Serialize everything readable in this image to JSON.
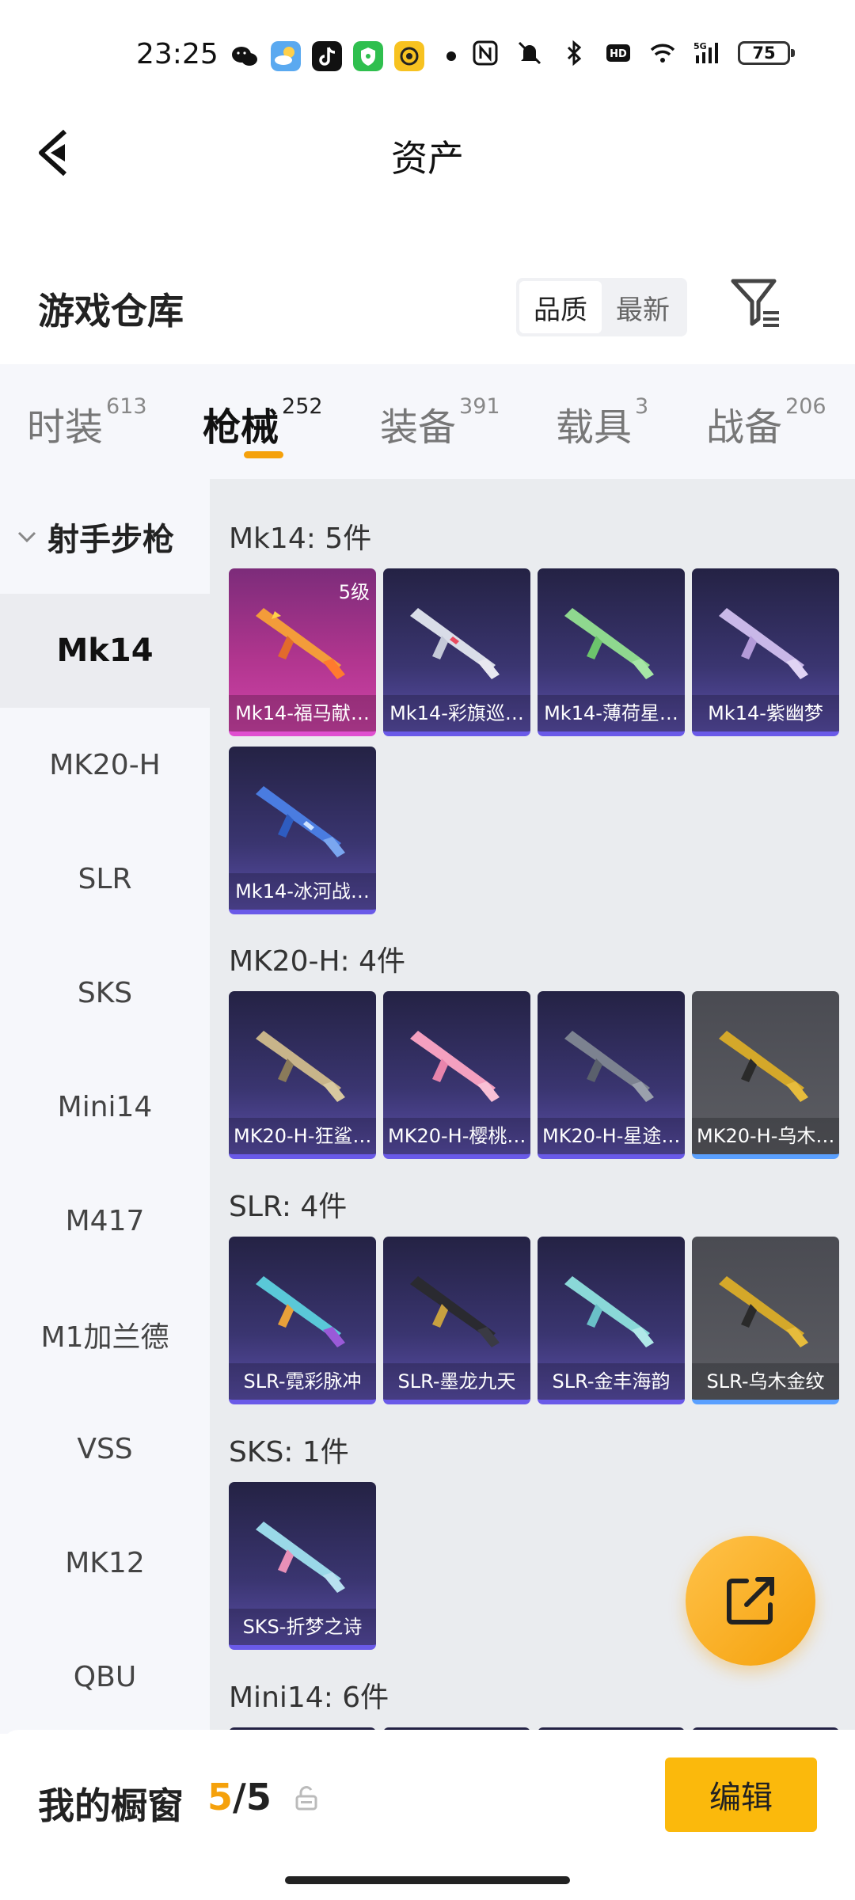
{
  "status_bar": {
    "time": "23:25",
    "battery": "75",
    "network": "5G",
    "app_icons": [
      "wechat-icon",
      "weather-icon",
      "tiktok-icon",
      "shield-app-icon",
      "camera-app-icon"
    ],
    "system_icons": [
      "nfc-icon",
      "mute-icon",
      "bluetooth-icon",
      "hd-icon",
      "wifi-icon",
      "signal-icon"
    ]
  },
  "nav": {
    "title": "资产"
  },
  "warehouse": {
    "title": "游戏仓库",
    "sort_options": [
      "品质",
      "最新"
    ],
    "sort_selected": "品质"
  },
  "tabs": [
    {
      "label": "时装",
      "count": "613"
    },
    {
      "label": "枪械",
      "count": "252"
    },
    {
      "label": "装备",
      "count": "391"
    },
    {
      "label": "载具",
      "count": "3"
    },
    {
      "label": "战备",
      "count": "206"
    }
  ],
  "active_tab": "枪械",
  "sidebar": {
    "category": "射手步枪",
    "items": [
      "Mk14",
      "MK20-H",
      "SLR",
      "SKS",
      "Mini14",
      "M417",
      "M1加兰德",
      "VSS",
      "MK12",
      "QBU"
    ],
    "active": "Mk14"
  },
  "sections": [
    {
      "title": "Mk14: 5件",
      "items": [
        {
          "name": "Mk14-福马献…",
          "level": "5级",
          "rarity": "pink"
        },
        {
          "name": "Mk14-彩旗巡…",
          "rarity": "purple"
        },
        {
          "name": "Mk14-薄荷星…",
          "rarity": "purple"
        },
        {
          "name": "Mk14-紫幽梦",
          "rarity": "purple"
        },
        {
          "name": "Mk14-冰河战…",
          "rarity": "purple"
        }
      ]
    },
    {
      "title": "MK20-H: 4件",
      "items": [
        {
          "name": "MK20-H-狂鲨…",
          "rarity": "purple"
        },
        {
          "name": "MK20-H-樱桃…",
          "rarity": "purple"
        },
        {
          "name": "MK20-H-星途…",
          "rarity": "purple"
        },
        {
          "name": "MK20-H-乌木…",
          "rarity": "gray"
        }
      ]
    },
    {
      "title": "SLR: 4件",
      "items": [
        {
          "name": "SLR-霓彩脉冲",
          "rarity": "purple"
        },
        {
          "name": "SLR-墨龙九天",
          "rarity": "purple"
        },
        {
          "name": "SLR-金丰海韵",
          "rarity": "purple"
        },
        {
          "name": "SLR-乌木金纹",
          "rarity": "gray"
        }
      ]
    },
    {
      "title": "SKS: 1件",
      "items": [
        {
          "name": "SKS-折梦之诗",
          "rarity": "purple"
        }
      ]
    },
    {
      "title": "Mini14: 6件",
      "items": []
    }
  ],
  "showcase": {
    "label": "我的橱窗",
    "current": "5",
    "separator": "/",
    "total": "5",
    "edit_label": "编辑"
  },
  "colors": {
    "accent": "#f5a10b",
    "button": "#fbb90c"
  }
}
